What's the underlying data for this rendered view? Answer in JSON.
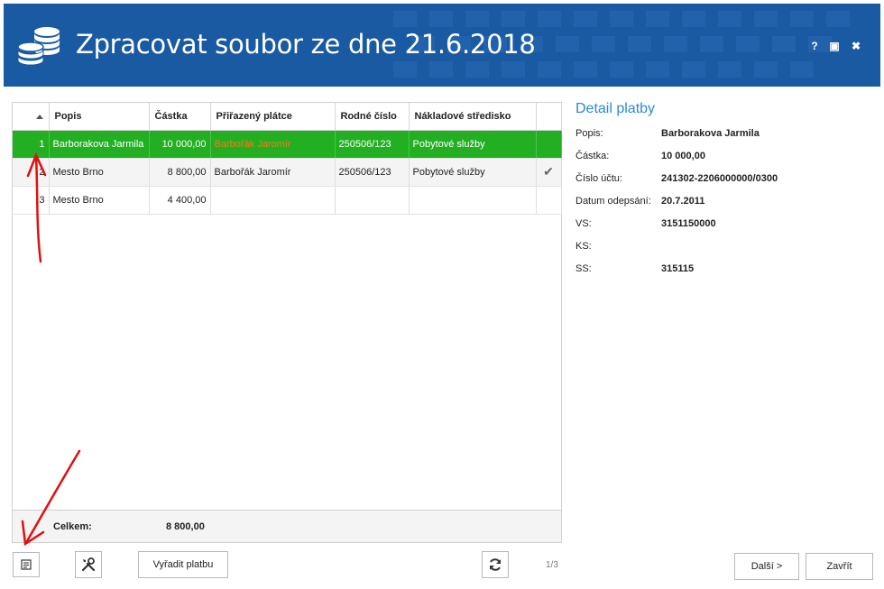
{
  "window": {
    "title": "Zpracovat soubor ze dne 21.6.2018",
    "controls": {
      "help": "?",
      "maximize": "▣",
      "close": "✖"
    }
  },
  "grid": {
    "columns": [
      "",
      "Popis",
      "Částka",
      "Přiřazený plátce",
      "Rodné číslo",
      "Nákladové středisko",
      ""
    ],
    "rows": [
      {
        "n": "1",
        "popis": "Barborakova Jarmila",
        "castka": "10 000,00",
        "platce": "Barbořák Jaromír",
        "rc": "250506/123",
        "stredisko": "Pobytové služby",
        "check": ""
      },
      {
        "n": "2",
        "popis": "Mesto Brno",
        "castka": "8 800,00",
        "platce": "Barbořák Jaromír",
        "rc": "250506/123",
        "stredisko": "Pobytové služby",
        "check": "✔"
      },
      {
        "n": "3",
        "popis": "Mesto Brno",
        "castka": "4 400,00",
        "platce": "",
        "rc": "",
        "stredisko": "",
        "check": ""
      }
    ],
    "footer": {
      "label": "Celkem:",
      "value": "8 800,00"
    }
  },
  "detail": {
    "title": "Detail platby",
    "fields": [
      {
        "key": "Popis:",
        "value": "Barborakova Jarmila"
      },
      {
        "key": "Částka:",
        "value": "10 000,00"
      },
      {
        "key": "Číslo účtu:",
        "value": "241302-2206000000/0300"
      },
      {
        "key": "Datum odepsání:",
        "value": "20.7.2011"
      },
      {
        "key": "VS:",
        "value": "3151150000"
      },
      {
        "key": "KS:",
        "value": ""
      },
      {
        "key": "SS:",
        "value": "315115"
      }
    ]
  },
  "toolbar": {
    "discard_label": "Vyřadit platbu",
    "pager": "1/3",
    "next_label": "Další >",
    "close_label": "Zavřít"
  },
  "colors": {
    "header_bg": "#1a5aa3",
    "selected_row": "#22b022",
    "accent_title": "#2a8bd1",
    "arrow": "#e01010"
  },
  "icons": [
    "coins-icon",
    "report-icon",
    "tools-icon",
    "refresh-icon",
    "checkmark-icon",
    "sort-up-icon"
  ]
}
